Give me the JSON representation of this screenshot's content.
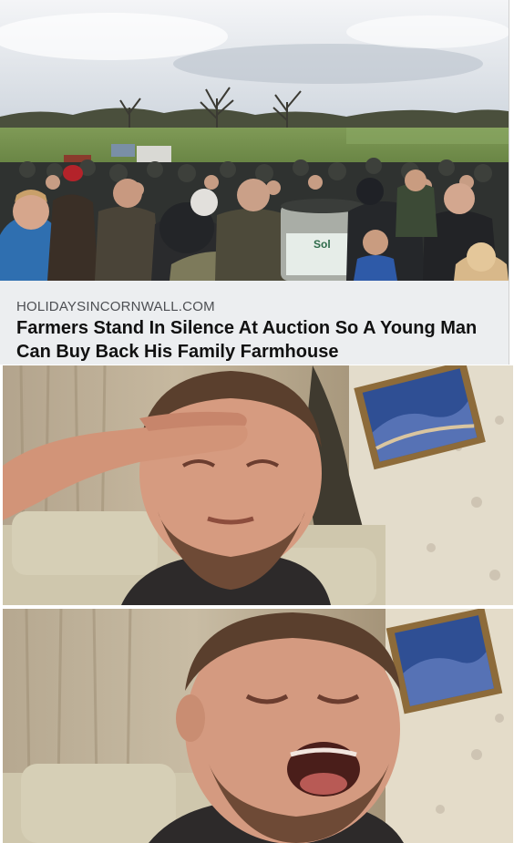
{
  "article": {
    "source": "HOLIDAYSINCORNWALL.COM",
    "headline": "Farmers Stand In Silence At Auction So A Young Man Can Buy Back His Family Farmhouse"
  },
  "photo": {
    "sign_text": "Sol"
  },
  "colors": {
    "caption_background": "#eceef0",
    "headline_text": "#111111",
    "source_text": "#4d4f53",
    "sky": "#dfe4ea",
    "grass": "#6d8a4a"
  }
}
